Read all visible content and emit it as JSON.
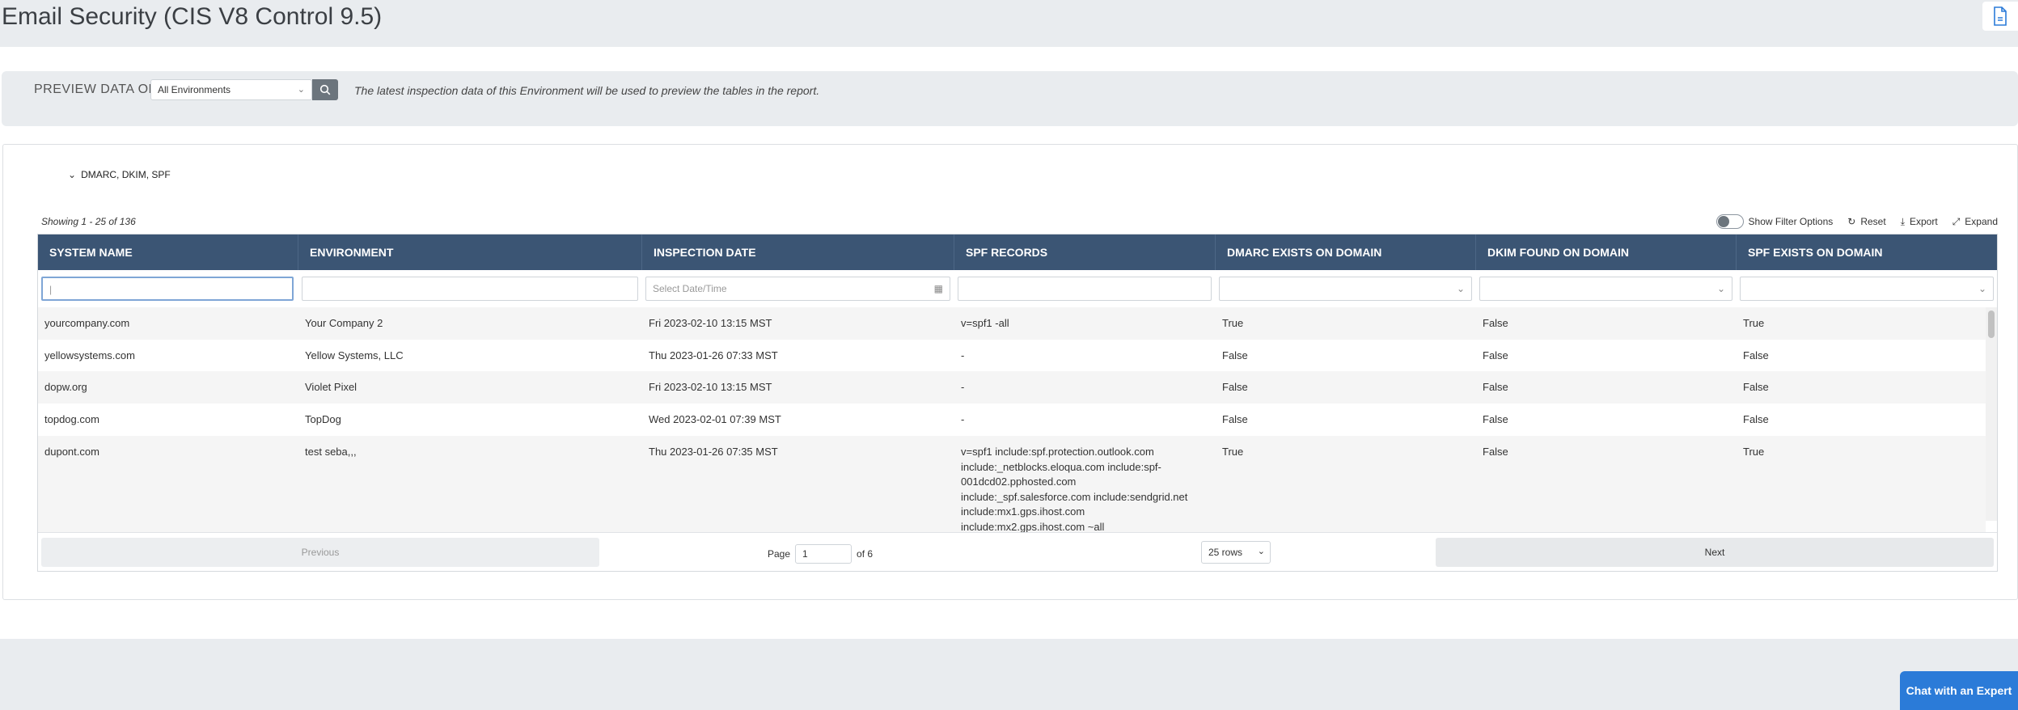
{
  "page": {
    "title": "Email Security (CIS V8 Control 9.5)"
  },
  "preview": {
    "label": "PREVIEW DATA OF",
    "environment": "All Environments",
    "note": "The latest inspection data of this Environment will be used to preview the tables in the report."
  },
  "section": {
    "title": "DMARC, DKIM, SPF"
  },
  "table": {
    "showing": "Showing 1 - 25 of 136",
    "tools": {
      "filter_label": "Show Filter Options",
      "reset_label": "Reset",
      "export_label": "Export",
      "expand_label": "Expand"
    },
    "columns": [
      "SYSTEM NAME",
      "ENVIRONMENT",
      "INSPECTION DATE",
      "SPF RECORDS",
      "DMARC EXISTS ON DOMAIN",
      "DKIM FOUND ON DOMAIN",
      "SPF EXISTS ON DOMAIN"
    ],
    "date_placeholder": "Select Date/Time",
    "rows": [
      [
        "yourcompany.com",
        "Your Company 2",
        "Fri 2023-02-10 13:15 MST",
        "v=spf1 -all",
        "True",
        "False",
        "True"
      ],
      [
        "yellowsystems.com",
        "Yellow Systems, LLC",
        "Thu 2023-01-26 07:33 MST",
        "-",
        "False",
        "False",
        "False"
      ],
      [
        "dopw.org",
        "Violet Pixel",
        "Fri 2023-02-10 13:15 MST",
        "-",
        "False",
        "False",
        "False"
      ],
      [
        "topdog.com",
        "TopDog",
        "Wed 2023-02-01 07:39 MST",
        "-",
        "False",
        "False",
        "False"
      ],
      [
        "dupont.com",
        "test seba,,,",
        "Thu 2023-01-26 07:35 MST",
        "v=spf1 include:spf.protection.outlook.com include:_netblocks.eloqua.com include:spf-001dcd02.pphosted.com include:_spf.salesforce.com include:sendgrid.net include:mx1.gps.ihost.com include:mx2.gps.ihost.com ~all",
        "True",
        "False",
        "True"
      ]
    ],
    "pager": {
      "previous_label": "Previous",
      "next_label": "Next",
      "page_label": "Page",
      "page_value": "1",
      "of_label": "of 6",
      "rows_label": "25 rows"
    }
  },
  "chat": {
    "label": "Chat with an Expert"
  },
  "colors": {
    "header_bg": "#3b5574",
    "accent": "#2b7bd8",
    "page_bg": "#e9ecef"
  }
}
